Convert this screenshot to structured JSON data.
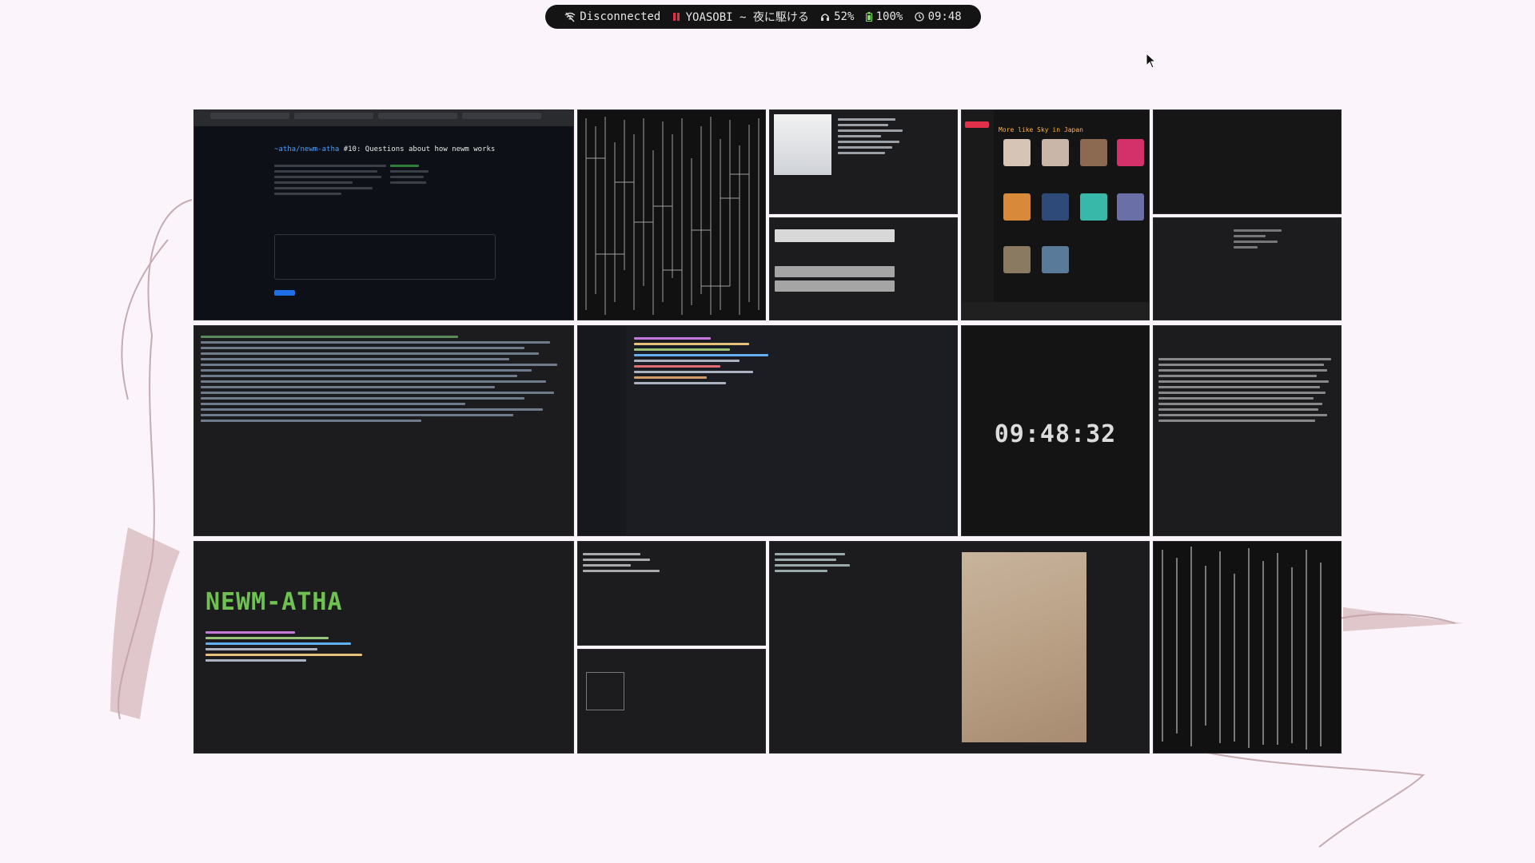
{
  "status_bar": {
    "network_label": "Disconnected",
    "music_label": "YOASOBI ~ 夜に駆ける",
    "volume": "52%",
    "battery": "100%",
    "time": "09:48"
  },
  "windows": {
    "browser": {
      "repo": "~atha/newm-atha",
      "issue_title": "#10: Questions about how newm works"
    },
    "music_player": {
      "heading": "More like Sky in Japan"
    },
    "clock": {
      "time": "09:48:32"
    },
    "editor_banner": {
      "text": "NEWM-ATHA"
    }
  },
  "icons": {
    "network": "wifi-off-icon",
    "music": "bars-icon",
    "volume": "headphones-icon",
    "battery": "battery-icon",
    "time": "clock-icon"
  },
  "colors": {
    "bar_bg": "#141414",
    "wallpaper": "#fbf4fa",
    "window_bg": "#1c1c1f",
    "music_accent": "#e0304a",
    "clock_text": "#dcdcdc",
    "banner_green": "#7ee05a"
  }
}
